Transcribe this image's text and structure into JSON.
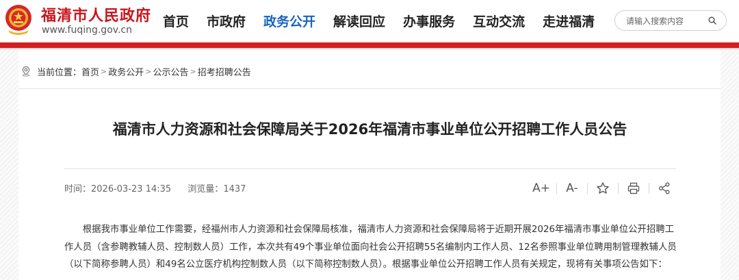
{
  "header": {
    "site_name": "福清市人民政府",
    "site_url": "www.fuqing.gov.cn",
    "nav": [
      {
        "label": "首页",
        "active": false
      },
      {
        "label": "市政府",
        "active": false
      },
      {
        "label": "政务公开",
        "active": true
      },
      {
        "label": "解读回应",
        "active": false
      },
      {
        "label": "办事服务",
        "active": false
      },
      {
        "label": "互动交流",
        "active": false
      },
      {
        "label": "走进福清",
        "active": false
      }
    ],
    "search": {
      "placeholder": "请输入搜索内容"
    }
  },
  "breadcrumb": {
    "prefix": "当前位置：",
    "items": [
      "首页",
      "政务公开",
      "公示公告",
      "招考招聘公告"
    ],
    "separator": ">"
  },
  "article": {
    "title": "福清市人力资源和社会保障局关于2026年福清市事业单位公开招聘工作人员公告",
    "time_label": "时间：",
    "time": "2026-03-23 14:35",
    "views_label": "浏览量：",
    "views": "1437",
    "tools": {
      "font_increase": "A+",
      "font_decrease": "A-"
    },
    "paragraph_lines": [
      "根据我市事业单位工作需要，经福州市人力资源和社会保障局核准，福清市人力资源和社会保障局将于近期开展2026年福清市事业单位公开招聘工",
      "作人员（含参聘教辅人员、控制数人员）工作，本次共有49个事业单位面向社会公开招聘55名编制内工作人员、12名参照事业单位聘用制管理教辅人员",
      "（以下简称参聘人员）和49名公立医疗机构控制数人员（以下简称控制数人员）。根据事业单位公开招聘工作人员有关规定，现将有关事项公告如下："
    ]
  },
  "colors": {
    "brand_red": "#c8161d",
    "accent_bar": "#d21f20",
    "nav_active": "#1764c0"
  }
}
